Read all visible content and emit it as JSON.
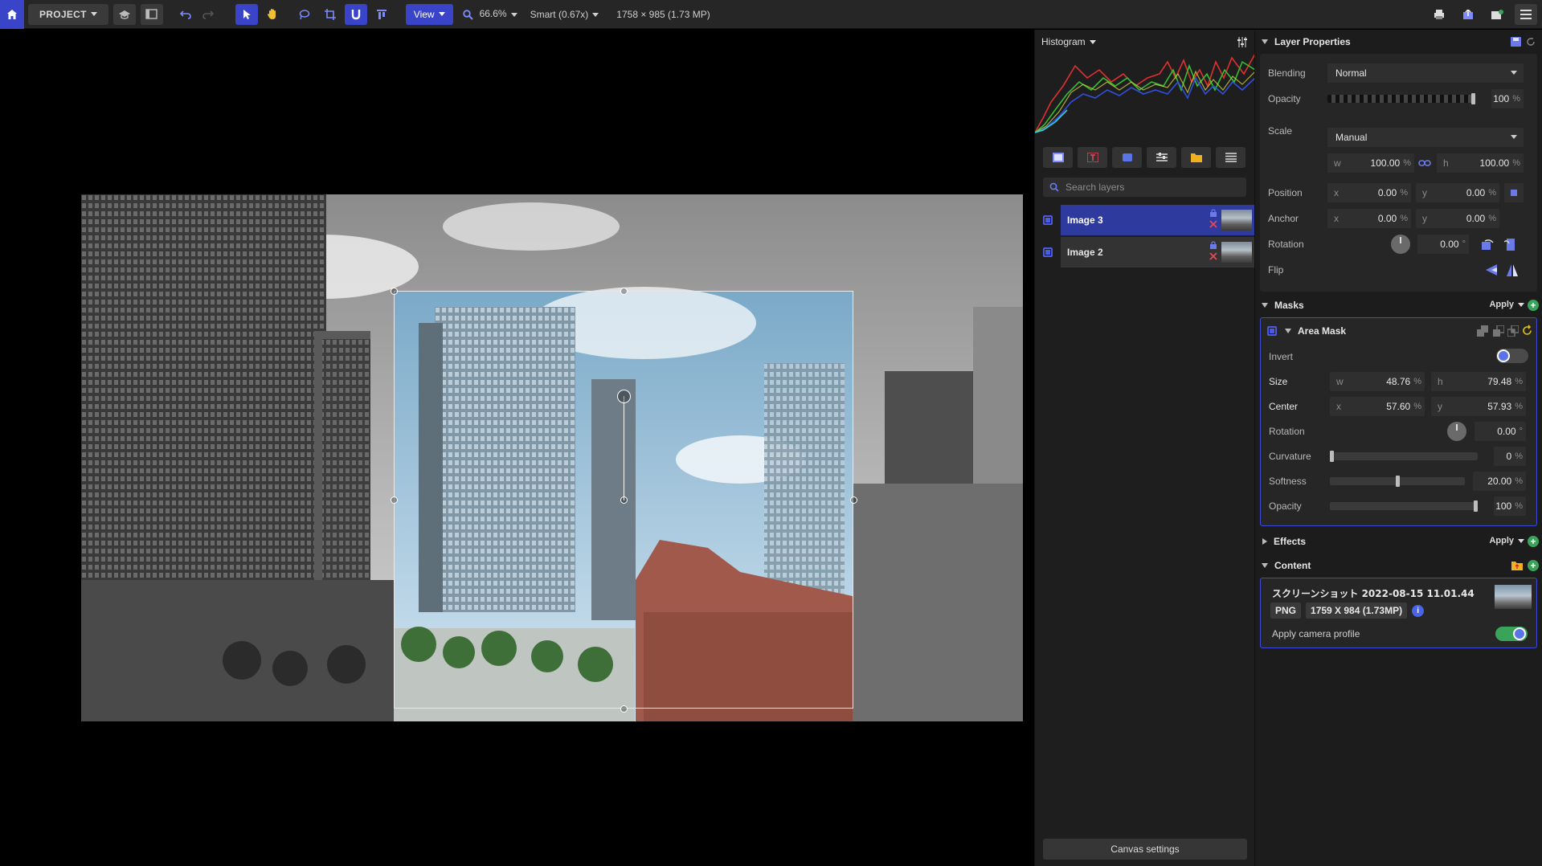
{
  "toolbar": {
    "project_label": "PROJECT",
    "view_label": "View",
    "zoom_value": "66.6%",
    "smart_label": "Smart (0.67x)",
    "image_size": "1758 × 985 (1.73 MP)"
  },
  "histogram": {
    "title": "Histogram"
  },
  "layers": {
    "search_placeholder": "Search layers",
    "items": [
      {
        "name": "Image 3",
        "selected": true
      },
      {
        "name": "Image 2",
        "selected": false
      }
    ],
    "canvas_settings_label": "Canvas settings"
  },
  "properties": {
    "layer_properties_title": "Layer Properties",
    "blending_label": "Blending",
    "blending_value": "Normal",
    "opacity_label": "Opacity",
    "opacity_value": "100",
    "scale_label": "Scale",
    "scale_value": "Manual",
    "scale_w_prefix": "w",
    "scale_w": "100.00",
    "scale_h_prefix": "h",
    "scale_h": "100.00",
    "position_label": "Position",
    "position_x": "0.00",
    "position_y": "0.00",
    "anchor_label": "Anchor",
    "anchor_x": "0.00",
    "anchor_y": "0.00",
    "rotation_label": "Rotation",
    "rotation_value": "0.00",
    "flip_label": "Flip",
    "percent": "%",
    "degree": "°",
    "x_prefix": "x",
    "y_prefix": "y"
  },
  "masks": {
    "title": "Masks",
    "apply_label": "Apply",
    "area_mask_title": "Area Mask",
    "invert_label": "Invert",
    "size_label": "Size",
    "size_w": "48.76",
    "size_h": "79.48",
    "center_label": "Center",
    "center_x": "57.60",
    "center_y": "57.93",
    "rotation_label": "Rotation",
    "rotation_value": "0.00",
    "curvature_label": "Curvature",
    "curvature_value": "0",
    "softness_label": "Softness",
    "softness_value": "20.00",
    "opacity_label": "Opacity",
    "opacity_value": "100"
  },
  "effects": {
    "title": "Effects",
    "apply_label": "Apply"
  },
  "content": {
    "title": "Content",
    "file_name": "スクリーンショット 2022-08-15 11.01.44",
    "format": "PNG",
    "dimensions": "1759 X 984 (1.73MP)",
    "camera_profile_label": "Apply camera profile"
  },
  "colors": {
    "accent": "#3a44c8",
    "selected_layer": "#2e3a9e",
    "mask_border": "#3d4bd8",
    "green_add": "#3aa35a"
  }
}
